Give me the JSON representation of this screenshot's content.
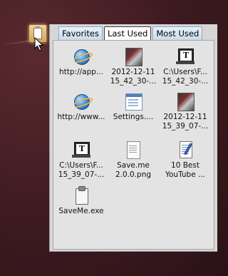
{
  "tabs": [
    {
      "label": "Favorites"
    },
    {
      "label": "Last Used"
    },
    {
      "label": "Most Used"
    }
  ],
  "items": [
    {
      "label1": "http://app...",
      "label2": "",
      "icon": "internet-explorer-icon"
    },
    {
      "label1": "2012-12-11",
      "label2": "15_42_30-...",
      "icon": "image-thumbnail-icon"
    },
    {
      "label1": "C:\\Users\\F...",
      "label2": "15_42_30-...",
      "icon": "text-tool-icon"
    },
    {
      "label1": "http://www...",
      "label2": "",
      "icon": "internet-explorer-icon"
    },
    {
      "label1": "Settings....",
      "label2": "",
      "icon": "settings-window-icon"
    },
    {
      "label1": "2012-12-11",
      "label2": "15_39_07-...",
      "icon": "image-thumbnail-icon"
    },
    {
      "label1": "C:\\Users\\F...",
      "label2": "15_39_07-...",
      "icon": "text-tool-icon"
    },
    {
      "label1": "Save.me",
      "label2": "2.0.0.png",
      "icon": "image-file-icon"
    },
    {
      "label1": "10 Best",
      "label2": "YouTube ...",
      "icon": "text-document-icon"
    },
    {
      "label1": "SaveMe.exe",
      "label2": "",
      "icon": "clipboard-icon"
    }
  ]
}
